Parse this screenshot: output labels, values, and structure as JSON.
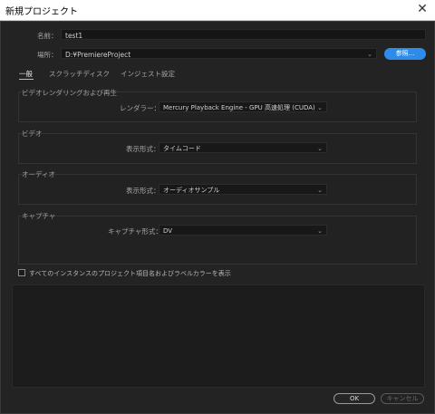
{
  "window": {
    "title": "新規プロジェクト",
    "close_glyph": "✕"
  },
  "form": {
    "name_label": "名前：",
    "name_value": "test1",
    "location_label": "場所：",
    "location_value": "D:¥PremiereProject",
    "browse_label": "参照..."
  },
  "tabs": [
    {
      "label": "一般",
      "active": true
    },
    {
      "label": "スクラッチディスク",
      "active": false
    },
    {
      "label": "インジェスト設定",
      "active": false
    }
  ],
  "sections": {
    "video_render": {
      "title": "ビデオレンダリングおよび再生",
      "field_label": "レンダラー：",
      "value": "Mercury Playback Engine - GPU 高速処理 (CUDA)"
    },
    "video": {
      "title": "ビデオ",
      "field_label": "表示形式：",
      "value": "タイムコード"
    },
    "audio": {
      "title": "オーディオ",
      "field_label": "表示形式：",
      "value": "オーディオサンプル"
    },
    "capture": {
      "title": "キャプチャ",
      "field_label": "キャプチャ形式：",
      "value": "DV"
    }
  },
  "checkbox": {
    "label": "すべてのインスタンスのプロジェクト項目名およびラベルカラーを表示",
    "checked": false
  },
  "buttons": {
    "ok": "OK",
    "cancel": "キャンセル"
  },
  "colors": {
    "accent": "#2d8ceb",
    "background": "#232323"
  },
  "icons": {
    "dropdown": "chevron-down-icon",
    "close": "close-icon"
  }
}
